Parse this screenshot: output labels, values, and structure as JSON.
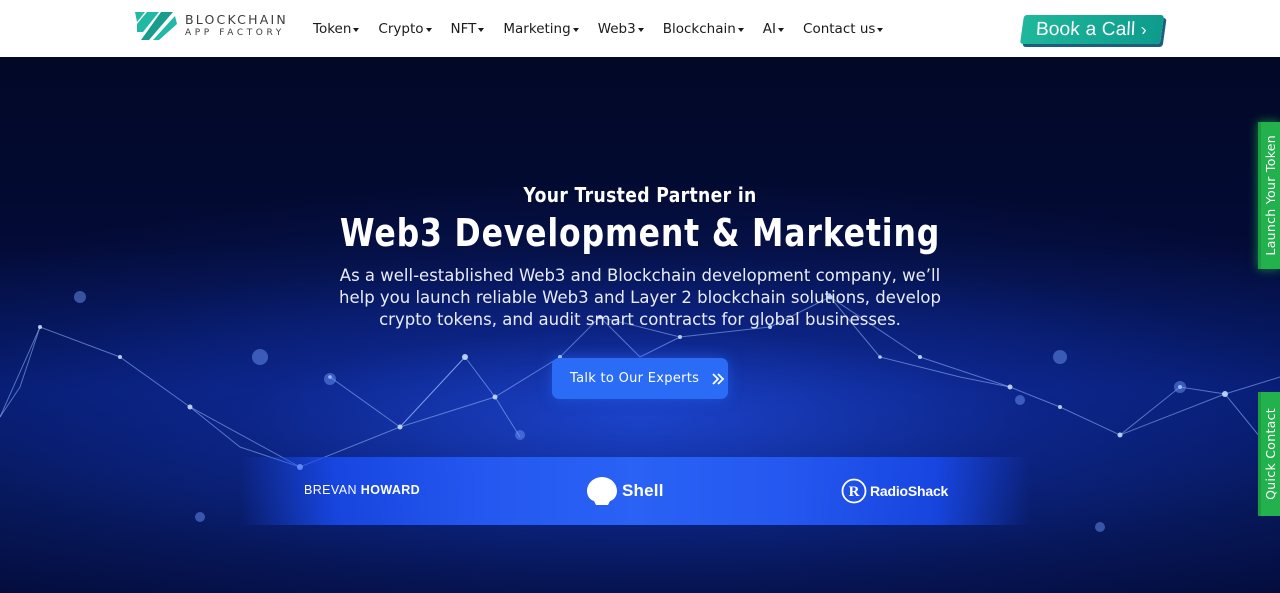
{
  "brand": {
    "name_line1": "BLOCKCHAIN",
    "name_line2": "APP FACTORY",
    "logo_color_primary": "#21b8a6",
    "logo_color_secondary": "#1a9c8c"
  },
  "nav": {
    "items": [
      {
        "label": "Token"
      },
      {
        "label": "Crypto"
      },
      {
        "label": "NFT"
      },
      {
        "label": "Marketing"
      },
      {
        "label": "Web3"
      },
      {
        "label": "Blockchain"
      },
      {
        "label": "AI"
      },
      {
        "label": "Contact us"
      }
    ],
    "cta": {
      "label": "Book a Call",
      "icon": "chevron-right-icon",
      "color": "#1fb89c"
    }
  },
  "hero": {
    "subtitle": "Your Trusted Partner in",
    "title": "Web3 Development & Marketing",
    "description": "As a well-established Web3 and Blockchain development company, we’ll help you launch reliable Web3 and Layer 2 blockchain solutions, develop crypto tokens, and audit smart contracts for global businesses.",
    "cta": {
      "label": "Talk to Our Experts",
      "icon": "double-chevron-right-icon",
      "color": "#2a6cf6"
    },
    "background_color": "#030b36"
  },
  "clients": {
    "logos": [
      {
        "name": "BREVAN HOWARD",
        "part1": "BREVAN",
        "part2": "HOWARD"
      },
      {
        "name": "Shell",
        "icon": "shell-icon"
      },
      {
        "name": "RadioShack",
        "icon": "registered-r-icon"
      }
    ],
    "strip_color": "#2a62f5"
  },
  "side_tabs": {
    "launch": {
      "label": "Launch Your Token",
      "color": "#22b14c"
    },
    "quick": {
      "label": "Quick Contact",
      "color": "#22b14c"
    }
  }
}
